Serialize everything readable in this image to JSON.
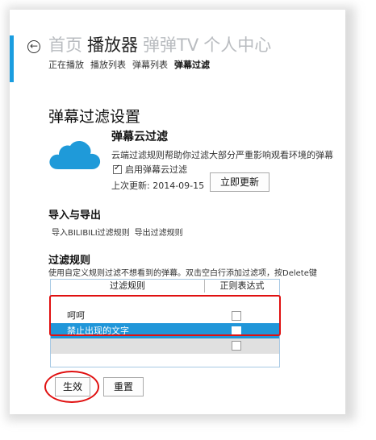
{
  "nav": {
    "main": [
      "首页",
      "播放器",
      "弹弹TV",
      "个人中心"
    ],
    "active_main": 1,
    "sub": [
      "正在播放",
      "播放列表",
      "弹幕列表",
      "弹幕过滤"
    ],
    "active_sub": 3
  },
  "page_title": "弹幕过滤设置",
  "cloud_filter": {
    "title": "弹幕云过滤",
    "description": "云端过滤规则帮助你过滤大部分严重影响观看环境的弹幕",
    "enable_label": "启用弹幕云过滤",
    "enabled": true,
    "last_update_label": "上次更新: 2014-09-15",
    "update_button": "立即更新"
  },
  "import_export": {
    "title": "导入与导出",
    "links": [
      "导入BILIBILI过滤规则",
      "导出过滤规则"
    ]
  },
  "filter_rules": {
    "title": "过滤规则",
    "description": "使用自定义规则过滤不想看到的弹幕。双击空白行添加过滤项，按Delete键",
    "columns": [
      "过滤规则",
      "正则表达式"
    ],
    "rows": [
      {
        "rule": "呵呵",
        "regex": false,
        "selected": false
      },
      {
        "rule": "禁止出现的文字",
        "regex": false,
        "selected": true
      },
      {
        "rule": "",
        "regex": false,
        "selected": false
      }
    ]
  },
  "buttons": {
    "apply": "生效",
    "reset": "重置"
  },
  "colors": {
    "accent": "#1a9de0",
    "selection": "#2096d9",
    "highlight": "#e01010",
    "cloud": "#1f9ad9"
  }
}
